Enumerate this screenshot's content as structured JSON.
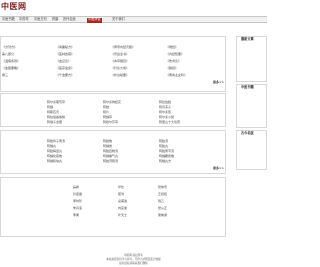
{
  "header": {
    "logo": "中医网"
  },
  "nav": [
    "中医书籍",
    "中药材",
    "中医方剂",
    "药膳",
    "历代名医",
    "中医辨证",
    "关于我们"
  ],
  "panels": [
    {
      "title": "",
      "more": "更多>>",
      "rows": [
        [
          "《方剂方》",
          "《青囊秘方》",
          "《黄帝内经灵枢》",
          "《难经》"
        ],
        [
          "第八部分",
          "《医林改错》",
          "《景岳全书》",
          "《内经知要》"
        ],
        [
          "《温病条辨》",
          "《血证论》",
          "《本草纲目》",
          "《伤寒论》"
        ],
        [
          "《金匮要略》",
          "《医宗金鉴》",
          "《针灸大成》",
          "《脉经》"
        ],
        [
          "卷三",
          "《千金要方》",
          "《外台秘要》",
          "《傅青主女科》"
        ]
      ]
    },
    {
      "title": "",
      "more": "更多>>",
      "rows": [
        [
          "",
          "阿尔泰葡萄草",
          "阿尔泰狗娃花",
          "阿拉伯胶"
        ],
        [
          "",
          "阿魏",
          "阿胶",
          "阿月浑子"
        ],
        [
          "",
          "阿斯匹灵",
          "阿片",
          "阿尔泰葱"
        ],
        [
          "",
          "阿拉伯婆婆纳",
          "阿魏草",
          "阿尔泰小檗"
        ],
        [
          "",
          "阿墩子龙胆",
          "阿穆尔莎草",
          "阿里山十大功劳"
        ]
      ]
    },
    {
      "title": "",
      "more": "更多>>",
      "rows": [
        [
          "",
          "阿胶鸡子黄汤",
          "阿胶散",
          "阿胶汤"
        ],
        [
          "",
          "阿魏丸",
          "阿魏膏",
          "阿胶丸"
        ],
        [
          "",
          "阿胶梅连丸",
          "阿胶四物汤",
          "阿胶黄芩汤"
        ],
        [
          "",
          "阿魏化痞膏",
          "阿魏撞气丸",
          "阿魏麝香散"
        ],
        [
          "",
          "阿魏积块丸",
          "阿胶济阴汤",
          "阿魏丸方"
        ]
      ]
    },
    {
      "title": "",
      "more": "更多>>",
      "rows": [
        [
          "",
          "扁鹊",
          "华佗",
          "张仲景"
        ],
        [
          "",
          "孙思邈",
          "葛洪",
          "王叔和"
        ],
        [
          "",
          "李时珍",
          "皇甫谧",
          "钱乙"
        ],
        [
          "",
          "朱丹溪",
          "刘完素",
          "张从正"
        ],
        [
          "",
          "李杲",
          "叶天士",
          "吴鞠通"
        ]
      ]
    }
  ],
  "side": [
    {
      "title": "最新文章"
    },
    {
      "title": "中医书籍"
    },
    {
      "title": "古今名医"
    }
  ],
  "footer": [
    "中医网 版权所有",
    "本站资源仅供学习参考，不作为诊断及医疗依据",
    "如有侵权请联系我们删除"
  ]
}
